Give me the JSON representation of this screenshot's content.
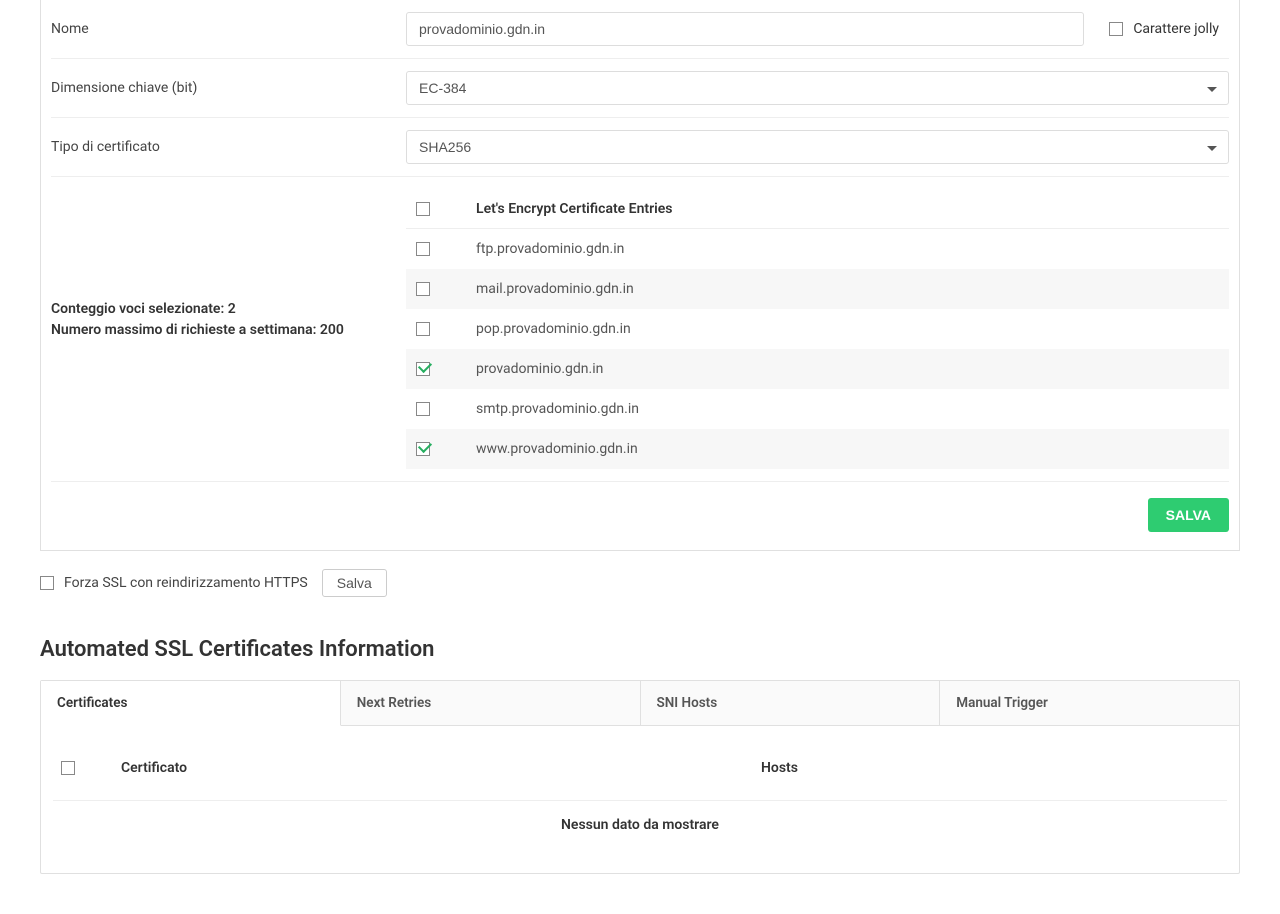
{
  "form": {
    "name_label": "Nome",
    "name_value": "provadominio.gdn.in",
    "wildcard_label": "Carattere jolly",
    "keysize_label": "Dimensione chiave (bit)",
    "keysize_value": "EC-384",
    "certtype_label": "Tipo di certificato",
    "certtype_value": "SHA256"
  },
  "entries": {
    "selected_count_label": "Conteggio voci selezionate: 2",
    "max_requests_label": "Numero massimo di richieste a settimana: 200",
    "header": "Let's Encrypt Certificate Entries",
    "items": [
      {
        "label": "ftp.provadominio.gdn.in",
        "checked": false
      },
      {
        "label": "mail.provadominio.gdn.in",
        "checked": false
      },
      {
        "label": "pop.provadominio.gdn.in",
        "checked": false
      },
      {
        "label": "provadominio.gdn.in",
        "checked": true
      },
      {
        "label": "smtp.provadominio.gdn.in",
        "checked": false
      },
      {
        "label": "www.provadominio.gdn.in",
        "checked": true
      }
    ]
  },
  "save_button": "SALVA",
  "force_ssl": {
    "label": "Forza SSL con reindirizzamento HTTPS",
    "save": "Salva"
  },
  "section_title": "Automated SSL Certificates Information",
  "tabs": [
    {
      "label": "Certificates"
    },
    {
      "label": "Next Retries"
    },
    {
      "label": "SNI Hosts"
    },
    {
      "label": "Manual Trigger"
    }
  ],
  "cert_table": {
    "col_cert": "Certificato",
    "col_hosts": "Hosts",
    "empty": "Nessun dato da mostrare"
  }
}
